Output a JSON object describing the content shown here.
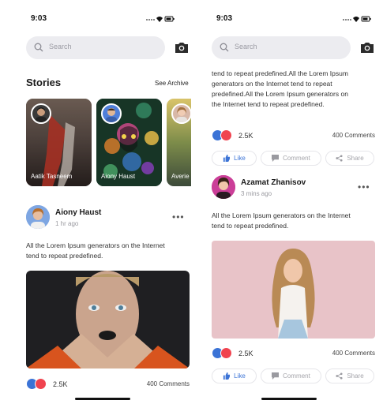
{
  "left": {
    "time": "9:03",
    "search_placeholder": "Search",
    "stories_title": "Stories",
    "see_archive": "See Archive",
    "stories": [
      {
        "name": "Aatik Tasneem"
      },
      {
        "name": "Aiony Haust"
      },
      {
        "name": "Averie"
      }
    ],
    "post": {
      "author": "Aiony Haust",
      "time": "1 hr ago",
      "text_line1": "All the Lorem Ipsum generators on the Internet",
      "text_line2": "tend to repeat predefined.",
      "reactions": "2.5K",
      "comments": "400 Comments"
    }
  },
  "right": {
    "time": "9:03",
    "search_placeholder": "Search",
    "top_text": [
      "tend to repeat predefined.All the Lorem Ipsum",
      "generators on the Internet tend to repeat",
      "predefined.All the Lorem Ipsum generators on",
      "the Internet tend to repeat predefined."
    ],
    "top_reactions": "2.5K",
    "top_comments": "400 Comments",
    "post": {
      "author": "Azamat Zhanisov",
      "time": "3 mins ago",
      "text_line1": "All the Lorem Ipsum generators on the Internet",
      "text_line2": "tend to repeat predefined.",
      "reactions": "2.5K",
      "comments": "400 Comments"
    }
  },
  "actions": {
    "like": "Like",
    "comment": "Comment",
    "share": "Share"
  },
  "colors": {
    "accent": "#3b73d6",
    "love": "#f0434f",
    "search_bg": "#ececf0"
  }
}
